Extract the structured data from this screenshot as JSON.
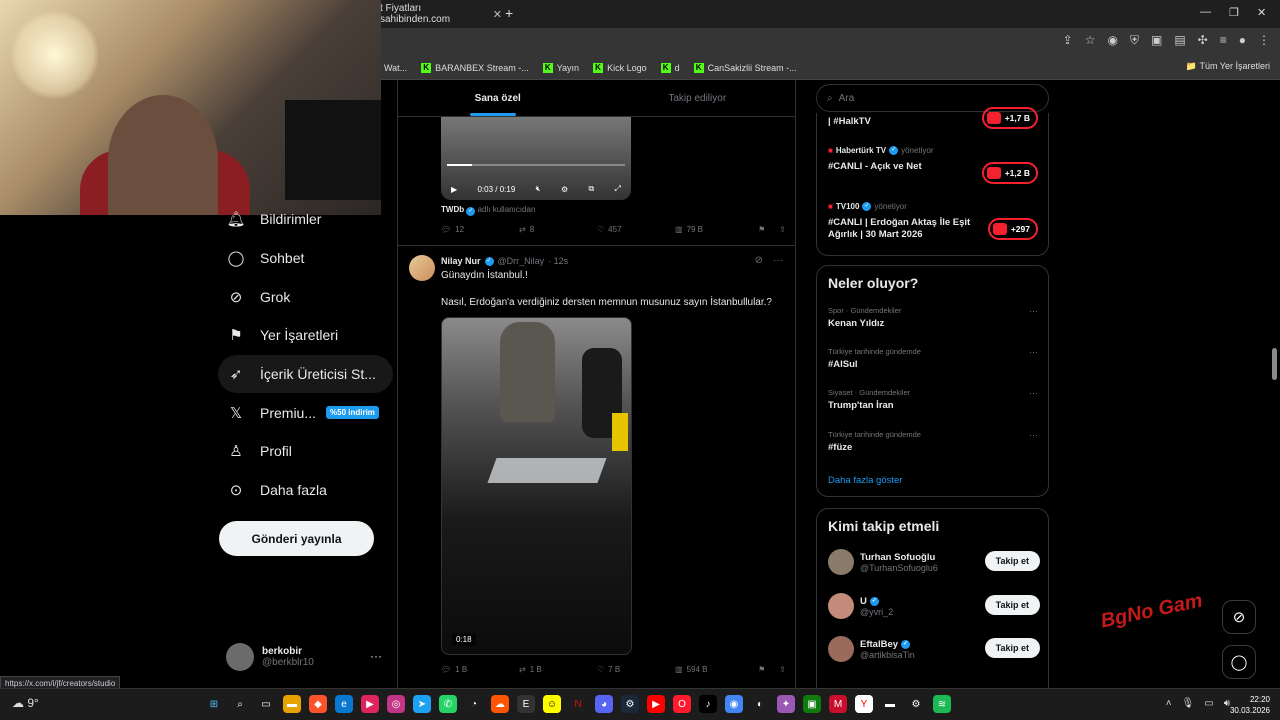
{
  "browser": {
    "tab_title": "t Fiyatları sahibinden.com",
    "bookmarks": [
      "Wat...",
      "BARANBEX Stream -...",
      "Yayın",
      "Kick Logo",
      "d",
      "CanSakizlii Stream -..."
    ],
    "all_bookmarks": "Tüm Yer İşaretleri",
    "status_url": "https://x.com/i/jf/creators/studio"
  },
  "nav": {
    "items": [
      {
        "label": "Bildirimler",
        "icon": "bell-icon"
      },
      {
        "label": "Sohbet",
        "icon": "chat-icon"
      },
      {
        "label": "Grok",
        "icon": "grok-icon"
      },
      {
        "label": "Yer İşaretleri",
        "icon": "bookmark-icon"
      },
      {
        "label": "İçerik Üreticisi St...",
        "icon": "rocket-icon"
      },
      {
        "label": "Premiu...",
        "icon": "x-logo-icon",
        "badge": "%50 indirim"
      },
      {
        "label": "Profil",
        "icon": "user-icon"
      },
      {
        "label": "Daha fazla",
        "icon": "more-circle-icon"
      }
    ],
    "post_button": "Gönderi yayınla",
    "profile_name": "berkobir",
    "profile_handle": "@berkblr10"
  },
  "feed": {
    "tabs": [
      "Sana özel",
      "Takip ediliyor"
    ],
    "tweet1": {
      "video_time": "0:03 / 0:19",
      "source_name": "TWDb",
      "source_suffix": "adlı kullanıcıdan",
      "replies": "12",
      "reposts": "8",
      "likes": "457",
      "views": "79 B"
    },
    "tweet2": {
      "name": "Nilay Nur",
      "handle": "@Drr_Nilay",
      "time": "· 12s",
      "line1": "Günaydın İstanbul.!",
      "line2": "Nasıl, Erdoğan'a verdiğiniz dersten memnun musunuz sayın İstanbullular.?",
      "video_duration": "0:18",
      "replies": "1 B",
      "reposts": "1 B",
      "likes": "7 B",
      "views": "594 B"
    }
  },
  "right": {
    "search_placeholder": "Ara",
    "live": [
      {
        "title": "| #HalkTV",
        "count": "+1,7 B"
      },
      {
        "channel": "Habertürk TV",
        "role": "yönetiyor",
        "title": "#CANLI - Açık ve Net",
        "count": "+1,2 B"
      },
      {
        "channel": "TV100",
        "role": "yönetiyor",
        "title": "#CANLI | Erdoğan Aktaş İle Eşit Ağırlık | 30 Mart 2026",
        "count": "+297"
      }
    ],
    "trends_title": "Neler oluyor?",
    "trends": [
      {
        "category": "Spor · Gündemdekiler",
        "name": "Kenan Yıldız"
      },
      {
        "category": "Türkiye tarihinde gündemde",
        "name": "#AlSul"
      },
      {
        "category": "Siyaset · Gündemdekiler",
        "name": "Trump'tan İran"
      },
      {
        "category": "Türkiye tarihinde gündemde",
        "name": "#füze"
      }
    ],
    "show_more": "Daha fazla göster",
    "who_title": "Kimi takip etmeli",
    "who": [
      {
        "name": "Turhan Sofuoğlu",
        "handle": "@TurhanSofuoglu6",
        "button": "Takip et"
      },
      {
        "name": "U",
        "handle": "@yvri_2",
        "button": "Takip et"
      },
      {
        "name": "EftalBey",
        "handle": "@artikbisaTin",
        "button": "Takip et"
      }
    ]
  },
  "overlay_logo": "BgNo Gam",
  "taskbar": {
    "weather": "9°",
    "time": "22:20",
    "date": "30.03.2026"
  },
  "colors": {
    "accent": "#1d9bf0",
    "live": "#f4212e",
    "kick": "#53fc18"
  }
}
